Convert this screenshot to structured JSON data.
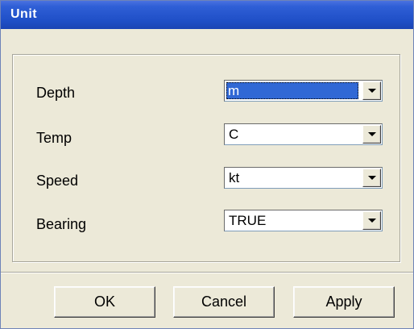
{
  "window": {
    "title": "Unit"
  },
  "fields": [
    {
      "label": "Depth",
      "value": "m"
    },
    {
      "label": "Temp",
      "value": "C"
    },
    {
      "label": "Speed",
      "value": "kt"
    },
    {
      "label": "Bearing",
      "value": "TRUE"
    }
  ],
  "buttons": {
    "ok": "OK",
    "cancel": "Cancel",
    "apply": "Apply"
  },
  "icons": {
    "dropdown": "chevron-down-icon"
  },
  "colors": {
    "titlebar": "#2058d8",
    "face": "#ece9d8",
    "selection": "#3168d5"
  }
}
